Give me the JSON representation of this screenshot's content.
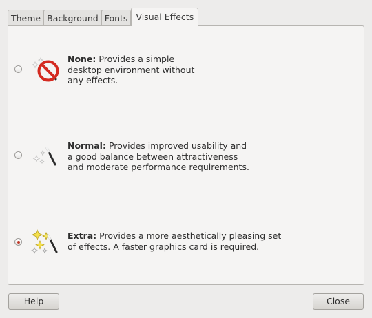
{
  "tabs": [
    {
      "label": "Theme"
    },
    {
      "label": "Background"
    },
    {
      "label": "Fonts"
    },
    {
      "label": "Visual Effects",
      "active": true
    }
  ],
  "options": [
    {
      "id": "none",
      "title": "None:",
      "lines": [
        "Provides a simple",
        "desktop environment without",
        "any effects."
      ],
      "icon": "no-effects-icon",
      "checked": false
    },
    {
      "id": "normal",
      "title": "Normal:",
      "lines": [
        "Provides improved usability and",
        "a good balance between attractiveness",
        "and moderate performance requirements."
      ],
      "icon": "magic-wand-icon",
      "checked": false
    },
    {
      "id": "extra",
      "title": "Extra:",
      "lines": [
        "Provides a more aesthetically pleasing set",
        "of effects. A faster graphics card is required."
      ],
      "icon": "sparkle-wand-icon",
      "checked": true
    }
  ],
  "buttons": {
    "help": "Help",
    "close": "Close"
  },
  "colors": {
    "radio_selected": "#c0392b",
    "prohibition_red": "#d42a20"
  }
}
